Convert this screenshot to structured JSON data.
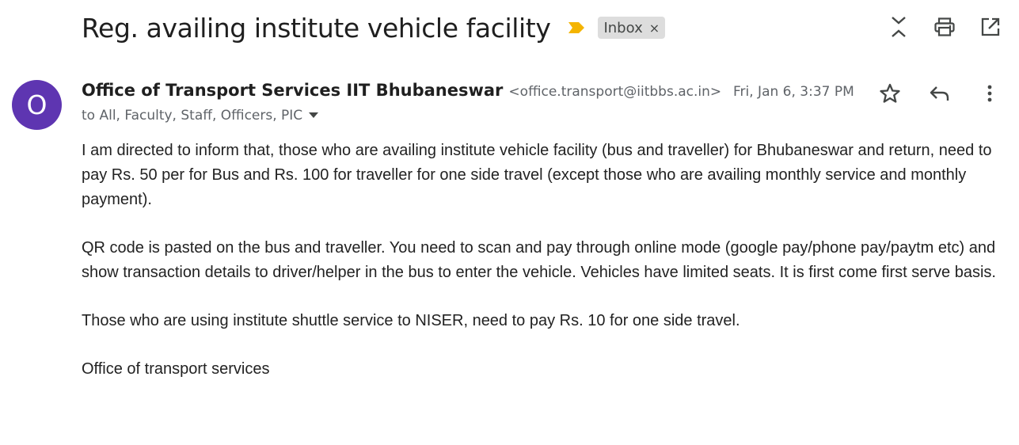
{
  "subject": "Reg. availing institute vehicle facility",
  "label": {
    "text": "Inbox",
    "close": "×"
  },
  "top_actions": [
    "collapse-all-icon",
    "print-icon",
    "open-in-new-window-icon"
  ],
  "sender": {
    "avatar_letter": "O",
    "avatar_color": "#5e35b1",
    "name": "Office of Transport Services IIT Bhubaneswar",
    "email": "<office.transport@iitbbs.ac.in>",
    "recipients": "to All, Faculty, Staff, Officers, PIC",
    "date": "Fri, Jan 6, 3:37 PM"
  },
  "message_actions": [
    "star-icon",
    "reply-icon",
    "more-vert-icon"
  ],
  "body": {
    "paragraphs": [
      "I am directed to inform that, those who are availing institute vehicle facility (bus and traveller) for Bhubaneswar and return, need to pay Rs. 50 per for Bus and Rs. 100 for traveller for one side travel (except those who are availing monthly service and monthly payment).",
      "QR code is pasted on the bus and traveller. You need to scan and pay through online mode (google pay/phone pay/paytm etc) and show transaction details to driver/helper in the bus to enter the vehicle. Vehicles have limited seats. It is first come first serve basis.",
      "Those who are using institute shuttle service to NISER, need to pay Rs. 10 for one side travel.",
      "Office of transport services"
    ]
  },
  "colors": {
    "important_marker": "#f4b400",
    "chip_background": "#dddddd",
    "icon": "#444746"
  }
}
